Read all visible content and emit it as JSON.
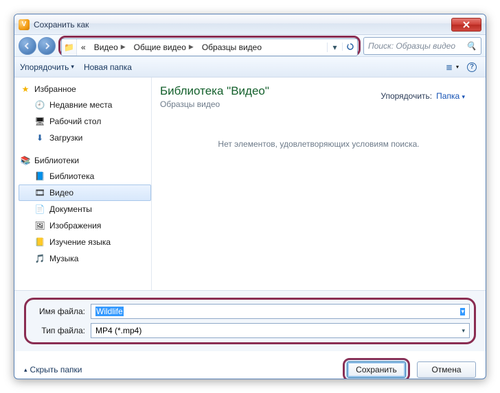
{
  "window": {
    "title": "Сохранить как"
  },
  "breadcrumb": {
    "prefix": "«",
    "items": [
      "Видео",
      "Общие видео",
      "Образцы видео"
    ]
  },
  "search": {
    "placeholder": "Поиск: Образцы видео"
  },
  "toolbar": {
    "organize": "Упорядочить",
    "new_folder": "Новая папка"
  },
  "sidebar": {
    "favorites": {
      "label": "Избранное",
      "items": [
        "Недавние места",
        "Рабочий стол",
        "Загрузки"
      ]
    },
    "libraries": {
      "label": "Библиотеки",
      "items": [
        "Библиотека",
        "Видео",
        "Документы",
        "Изображения",
        "Изучение языка",
        "Музыка"
      ],
      "selected_index": 1
    }
  },
  "content": {
    "lib_title": "Библиотека \"Видео\"",
    "lib_subtitle": "Образцы видео",
    "sort_label": "Упорядочить:",
    "sort_value": "Папка",
    "empty_text": "Нет элементов, удовлетворяющих условиям поиска."
  },
  "filename": {
    "label": "Имя файла:",
    "value": "Wildlife"
  },
  "filetype": {
    "label": "Тип файла:",
    "value": "MP4 (*.mp4)"
  },
  "footer": {
    "hide_folders": "Скрыть папки",
    "save": "Сохранить",
    "cancel": "Отмена"
  },
  "icons": {
    "star": "★",
    "recent": "🕘",
    "desktop": "🖥",
    "downloads": "⬇",
    "libs": "📚",
    "lib": "📘",
    "video": "🎞",
    "docs": "📄",
    "images": "🖼",
    "lang": "📒",
    "music": "🎵",
    "folder": "📁",
    "search": "🔍",
    "help": "?",
    "view": "≣"
  }
}
